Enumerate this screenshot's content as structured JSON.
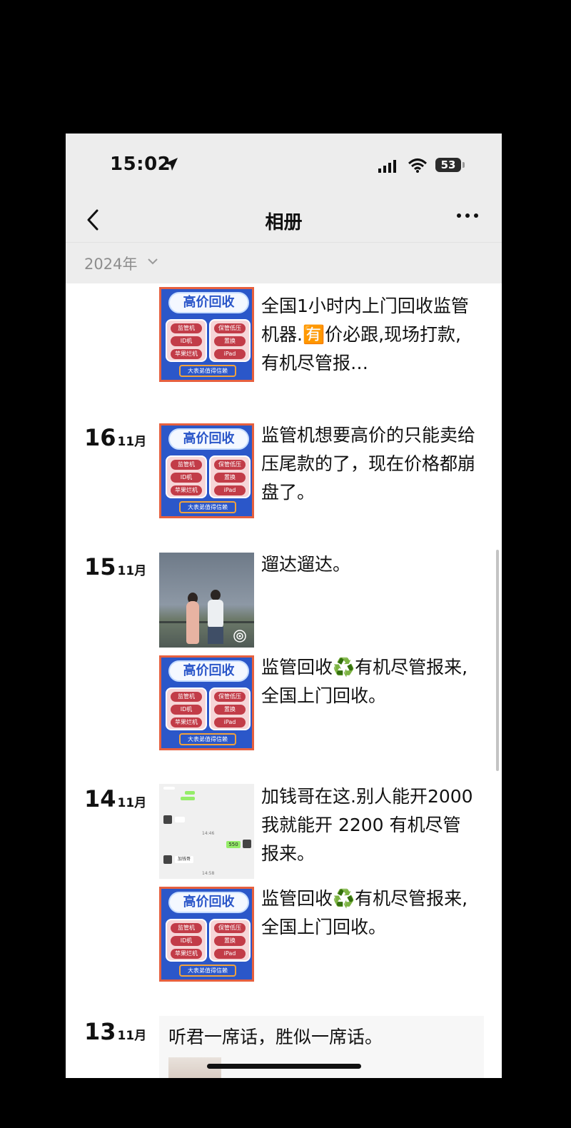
{
  "status_bar": {
    "time": "15:02",
    "battery": "53"
  },
  "nav": {
    "title": "相册"
  },
  "filter": {
    "year": "2024年"
  },
  "posts": [
    {
      "caption": "全国1小时内上门回收监管机器.🈶价必跟,现场打款,有机尽管报…"
    },
    {
      "day": "16",
      "month": "11月",
      "caption": "监管机想要高价的只能卖给压尾款的了，现在价格都崩盘了。"
    },
    {
      "day": "15",
      "month": "11月",
      "caption": "遛达遛达。"
    },
    {
      "caption": "监管回收♻️有机尽管报来,全国上门回收。"
    },
    {
      "day": "14",
      "month": "11月",
      "caption": "加钱哥在这.别人能开2000 我就能开 2200 有机尽管报来。"
    },
    {
      "caption": "监管回收♻️有机尽管报来,全国上门回收。"
    },
    {
      "day": "13",
      "month": "11月",
      "caption": "听君一席话，胜似一席话。"
    }
  ],
  "promo": {
    "title": "高价回收",
    "left_items": [
      "监管机",
      "ID机",
      "苹果烂机"
    ],
    "right_items": [
      "保管低压",
      "置换",
      "iPad"
    ],
    "footer": "大表弟值得信赖"
  },
  "chat_shot": {
    "amount": "550",
    "name": "加钱哥"
  },
  "colors": {
    "promo_blue": "#2b57c9",
    "promo_red": "#c23c48",
    "nav_bg": "#ededed"
  }
}
